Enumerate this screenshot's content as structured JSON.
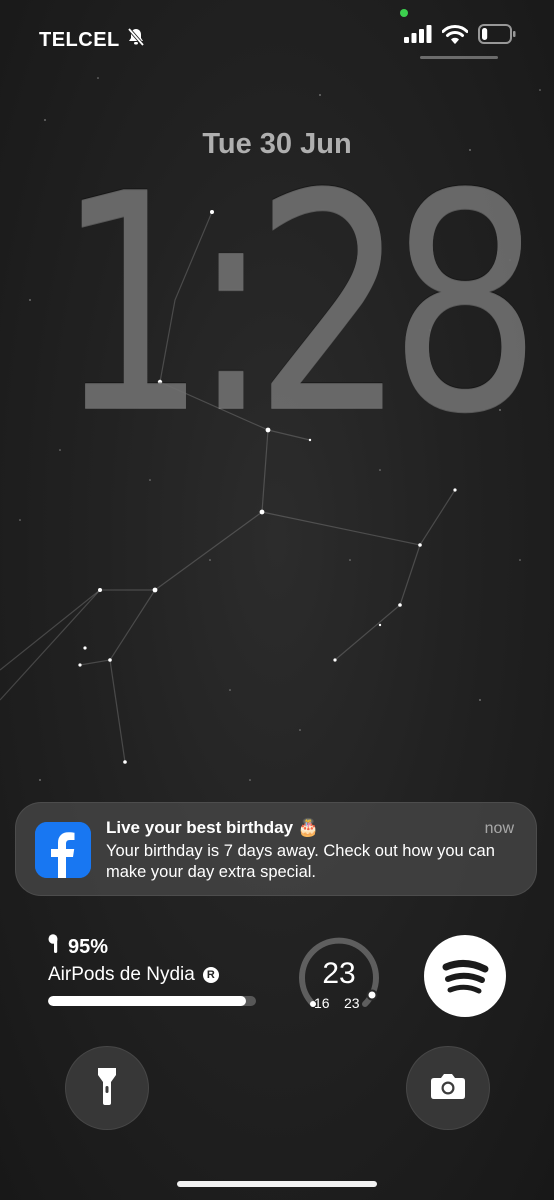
{
  "status_bar": {
    "carrier": "TELCEL",
    "silent_icon": "bell-slash-icon",
    "signal_icon": "cellular-signal-icon",
    "wifi_icon": "wifi-icon",
    "battery_icon": "battery-icon",
    "battery_level": 0.2,
    "privacy_indicator_color": "#3ccf4e"
  },
  "lockscreen": {
    "date": "Tue 30 Jun",
    "time": "1:28"
  },
  "notification": {
    "app_icon": "facebook-icon",
    "title": "Live your best birthday 🎂",
    "time": "now",
    "body": "Your birthday is 7 days away. Check out how you can make your day extra special."
  },
  "widgets": {
    "airpods": {
      "icon": "airpods-icon",
      "battery_text": "95%",
      "battery_level": 0.95,
      "device_name": "AirPods de Nydia",
      "registered_mark": "R"
    },
    "temperature": {
      "current": "23",
      "low": "16",
      "high": "23"
    },
    "spotify": {
      "icon": "spotify-icon"
    }
  },
  "quick_actions": {
    "flashlight_icon": "flashlight-icon",
    "camera_icon": "camera-icon"
  },
  "colors": {
    "facebook_blue": "#1877f2",
    "accent_white": "#ffffff"
  }
}
